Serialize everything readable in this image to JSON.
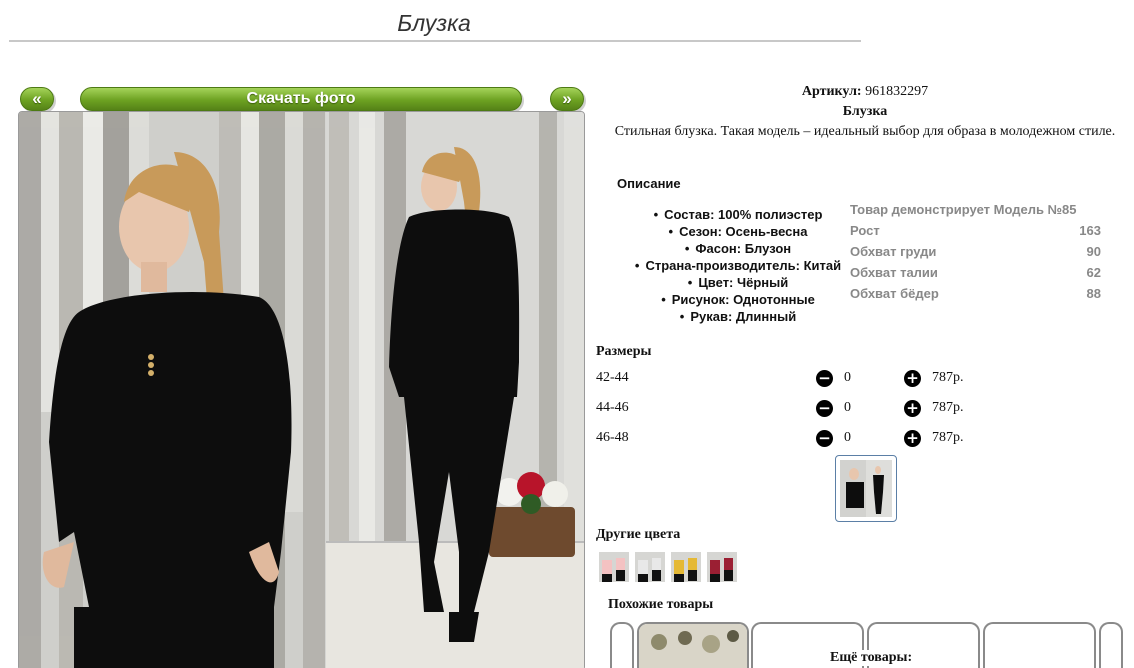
{
  "page": {
    "title": "Блузка"
  },
  "gallery": {
    "prev_label": "«",
    "download_label": "Скачать фото",
    "next_label": "»"
  },
  "product": {
    "article_label": "Артикул:",
    "article_value": "961832297",
    "name": "Блузка",
    "description": "Стильная блузка. Такая модель – идеальный выбор для образа в молодежном стиле."
  },
  "details": {
    "heading": "Описание",
    "items": [
      "Состав: 100% полиэстер",
      "Сезон: Осень-весна",
      "Фасон: Блузон",
      "Страна-производитель: Китай",
      "Цвет: Чёрный",
      "Рисунок: Однотонные",
      "Рукав: Длинный"
    ]
  },
  "model": {
    "heading": "Товар демонстрирует Модель №85",
    "rows": [
      {
        "label": "Рост",
        "value": "163"
      },
      {
        "label": "Обхват груди",
        "value": "90"
      },
      {
        "label": "Обхват талии",
        "value": "62"
      },
      {
        "label": "Обхват бёдер",
        "value": "88"
      }
    ]
  },
  "sizes": {
    "heading": "Размеры",
    "minus_glyph": "−",
    "plus_glyph": "+",
    "rows": [
      {
        "size": "42-44",
        "qty": "0",
        "price": "787р."
      },
      {
        "size": "44-46",
        "qty": "0",
        "price": "787р."
      },
      {
        "size": "46-48",
        "qty": "0",
        "price": "787р."
      }
    ]
  },
  "other_colors": {
    "heading": "Другие цвета",
    "swatches": [
      "#f4c2c2",
      "#e8e8e8",
      "#e5b935",
      "#9b1f33"
    ]
  },
  "similar": {
    "heading": "Похожие товары"
  },
  "more": {
    "heading": "Ещё товары:"
  },
  "colors": {
    "button_green": "#6da222",
    "blouse": "#0d0d0d",
    "hair": "#c89a5a"
  }
}
